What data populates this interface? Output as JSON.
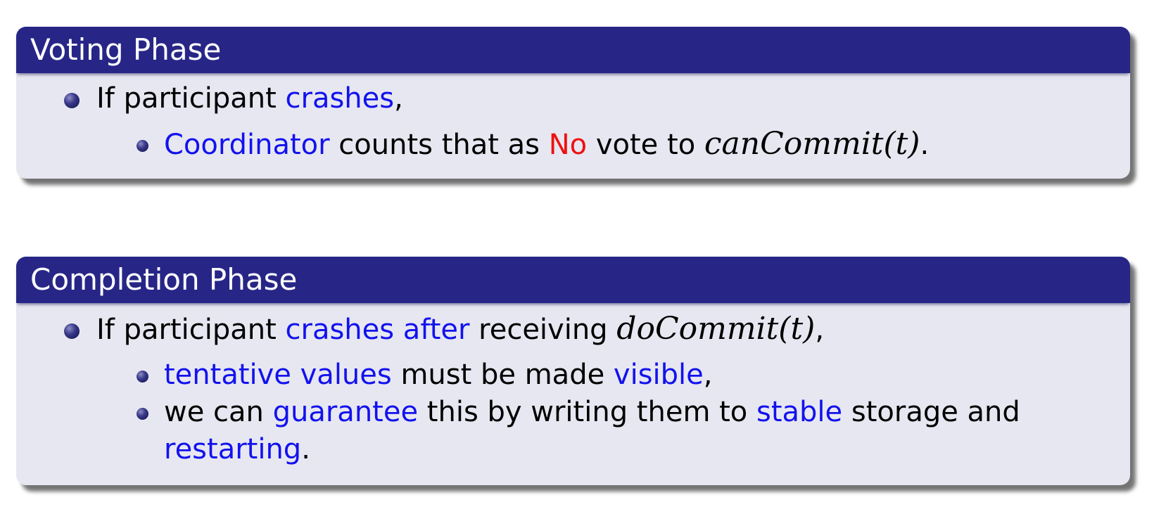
{
  "colors": {
    "title_bar": "#272687",
    "block_body": "#e7e7f1",
    "highlight": "#1212ee",
    "alert": "#ee1111",
    "bullet": "#2a2a7a"
  },
  "voting": {
    "title": "Voting Phase",
    "item1": {
      "t1": "If participant ",
      "h1": "crashes",
      "t2": ","
    },
    "sub1": {
      "h1": "Coordinator",
      "t1": " counts that as ",
      "r1": "No",
      "t2": " vote to ",
      "m1": "canCommit(t)",
      "t3": "."
    }
  },
  "completion": {
    "title": "Completion Phase",
    "item1": {
      "t1": "If participant ",
      "h1": "crashes after",
      "t2": " receiving ",
      "m1": "doCommit(t)",
      "t3": ","
    },
    "sub1": {
      "h1": "tentative values",
      "t1": " must be made ",
      "h2": "visible",
      "t2": ","
    },
    "sub2": {
      "t1": "we can ",
      "h1": "guarantee",
      "t2": " this by writing them to ",
      "h2": "stable",
      "t3": " storage and"
    },
    "sub2_cont": {
      "h1": "restarting",
      "t1": "."
    }
  }
}
